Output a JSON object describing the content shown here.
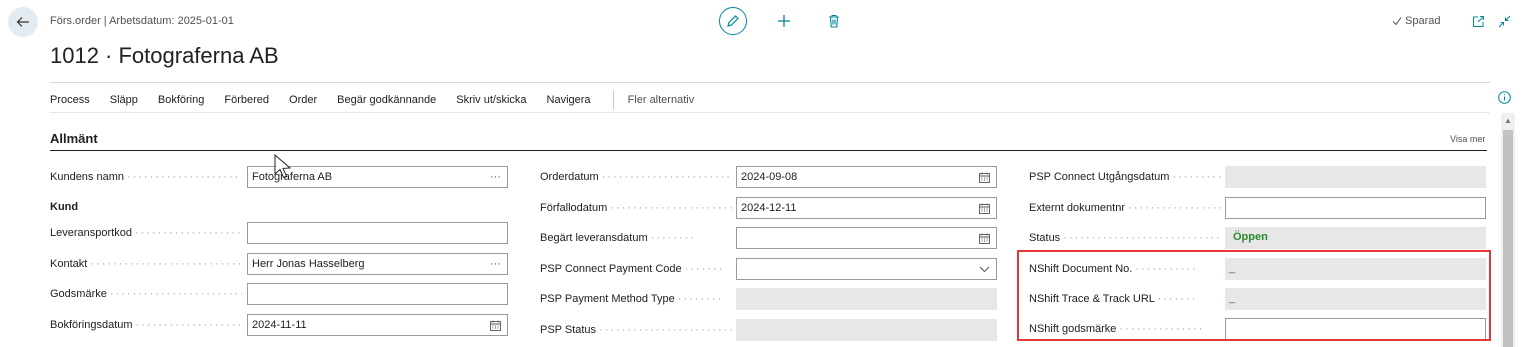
{
  "header": {
    "breadcrumb": "Förs.order | Arbetsdatum: 2025-01-01",
    "title": "1012 · Fotograferna AB",
    "saved_label": "Sparad"
  },
  "actions": [
    "Process",
    "Släpp",
    "Bokföring",
    "Förbered",
    "Order",
    "Begär godkännande",
    "Skriv ut/skicka",
    "Navigera"
  ],
  "more_options": "Fler alternativ",
  "section": {
    "title": "Allmänt",
    "show_more": "Visa mer"
  },
  "col1": {
    "customer_name_label": "Kundens namn",
    "customer_name_value": "Fotograferna AB",
    "kund_heading": "Kund",
    "delivery_code_label": "Leveransportkod",
    "delivery_code_value": "",
    "contact_label": "Kontakt",
    "contact_value": "Herr Jonas Hasselberg",
    "goods_mark_label": "Godsmärke",
    "goods_mark_value": "",
    "posting_date_label": "Bokföringsdatum",
    "posting_date_value": "2024-11-11"
  },
  "col2": {
    "order_date_label": "Orderdatum",
    "order_date_value": "2024-09-08",
    "due_date_label": "Förfallodatum",
    "due_date_value": "2024-12-11",
    "req_delivery_label": "Begärt leveransdatum",
    "req_delivery_value": "",
    "psp_payment_code_label": "PSP Connect Payment Code",
    "psp_payment_code_value": "",
    "psp_method_type_label": "PSP Payment Method Type",
    "psp_method_type_value": "",
    "psp_status_label": "PSP Status",
    "psp_status_value": ""
  },
  "col3": {
    "psp_expiry_label": "PSP Connect Utgångsdatum",
    "psp_expiry_value": "",
    "ext_doc_label": "Externt dokumentnr",
    "ext_doc_value": "",
    "status_label": "Status",
    "status_value": "Öppen",
    "nshift_doc_label": "NShift Document No.",
    "nshift_doc_value": "_",
    "nshift_track_label": "NShift Trace & Track URL",
    "nshift_track_value": "_",
    "nshift_mark_label": "NShift godsmärke",
    "nshift_mark_value": ""
  },
  "colors": {
    "accent": "#00889a",
    "status_green": "#2a8a2a",
    "highlight_red": "#e53935"
  }
}
